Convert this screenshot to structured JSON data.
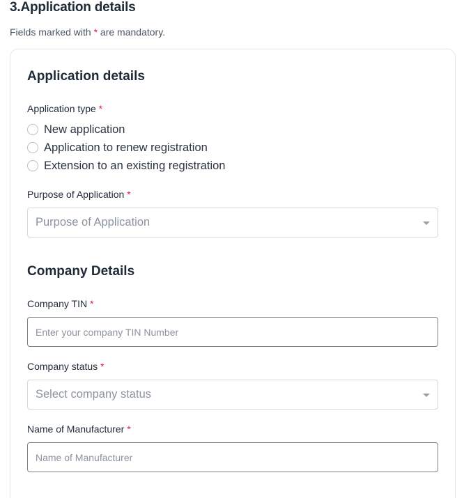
{
  "section": {
    "title": "3.Application details",
    "note_prefix": "Fields marked with ",
    "note_asterisk": "*",
    "note_suffix": " are mandatory."
  },
  "application": {
    "heading": "Application details",
    "type_label": "Application type",
    "type_options": [
      "New application",
      "Application to renew registration",
      "Extension to an existing registration"
    ],
    "purpose_label": "Purpose of Application",
    "purpose_value": "Purpose of Application"
  },
  "company": {
    "heading": "Company Details",
    "tin_label": "Company TIN",
    "tin_placeholder": "Enter your company TIN Number",
    "status_label": "Company status",
    "status_value": "Select company status",
    "manufacturer_label": "Name of Manufacturer",
    "manufacturer_placeholder": "Name of Manufacturer"
  },
  "required_marker": "*",
  "icons": {
    "radio": "radio-unchecked-icon",
    "dropdown": "chevron-down-icon"
  },
  "colors": {
    "required": "#e11d48",
    "input_border": "#7a8088",
    "select_border": "#d4d8de"
  }
}
